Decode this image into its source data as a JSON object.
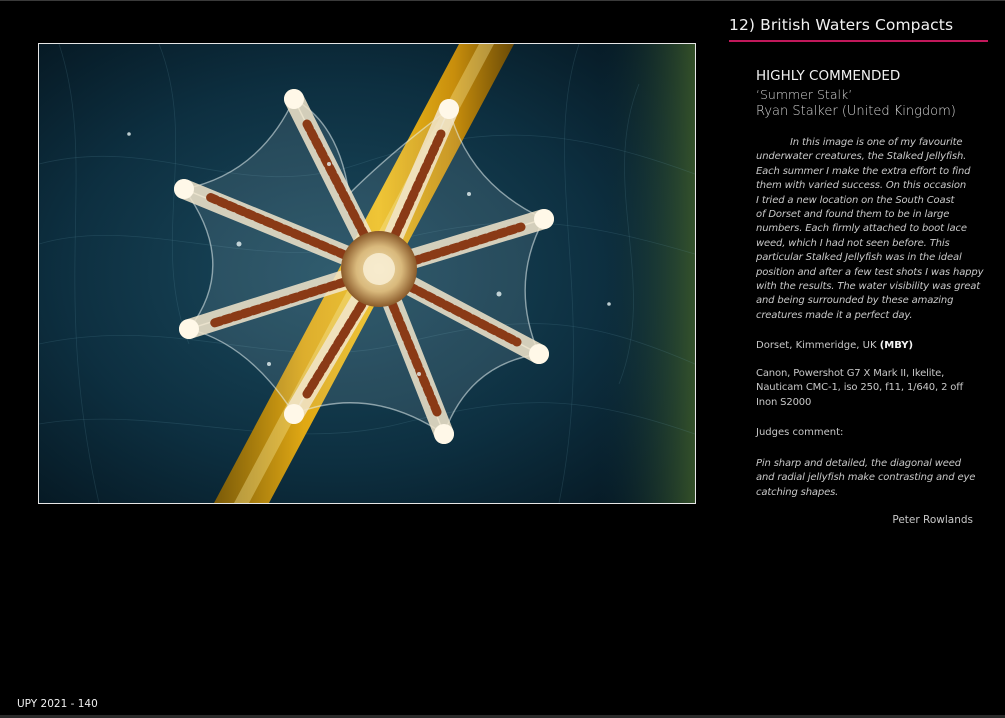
{
  "section": {
    "title": "12) British Waters Compacts"
  },
  "entry": {
    "award": "HIGHLY COMMENDED",
    "title": "‘Summer Stalk’",
    "author": "Ryan Stalker (United Kingdom)",
    "description_lines": [
      "In this image is one of my favourite",
      "underwater creatures, the Stalked Jellyfish.",
      "Each summer I make the extra effort to find",
      "them with varied success. On this occasion",
      "I tried a new location on the South Coast",
      "of Dorset and found them to be in large",
      "numbers. Each firmly attached to boot lace",
      "weed, which I had not seen before. This",
      "particular Stalked Jellyfish was in the ideal",
      "position and after a few test shots I was happy",
      "with the results. The water visibility was great",
      "and being surrounded by these amazing",
      "creatures made it a perfect day."
    ],
    "location": "Dorset, Kimmeridge, UK",
    "location_code": "(MBY)",
    "camera_lines": [
      "Canon, Powershot G7 X Mark II, Ikelite,",
      "Nauticam CMC-1, iso 250, f11, 1/640, 2 off",
      "Inon S2000"
    ],
    "judges_label": "Judges comment:",
    "judges_comment_lines": [
      "Pin sharp and detailed, the diagonal weed",
      "and radial jellyfish make contrasting and eye",
      "catching shapes."
    ],
    "judge_name": "Peter Rowlands"
  },
  "footer": {
    "page": "UPY 2021 - 140"
  },
  "colors": {
    "accent_rule": "#c2185b",
    "background": "#000000"
  },
  "photo": {
    "subject": "stalked-jellyfish-photo"
  }
}
